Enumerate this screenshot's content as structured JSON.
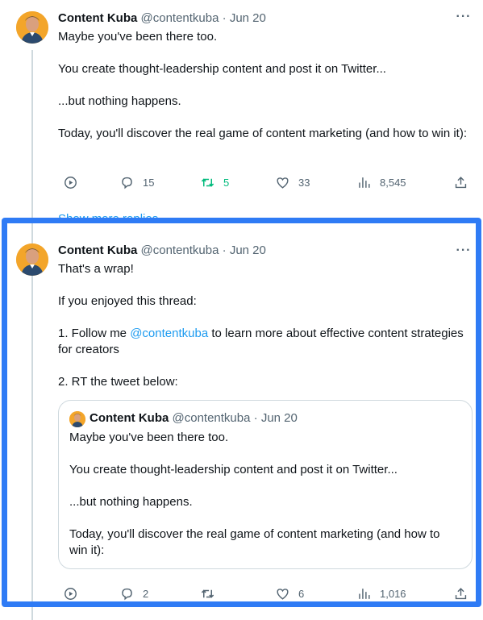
{
  "tweet1": {
    "author": "Content Kuba",
    "handle": "@contentkuba",
    "separator": "·",
    "date": "Jun 20",
    "more": "···",
    "paragraphs": [
      "Maybe you've been there too.",
      "You create thought-leadership content and post it on Twitter...",
      "...but nothing happens.",
      "Today, you'll discover the real game of content marketing (and how to win it):"
    ],
    "stats": {
      "replies": "15",
      "retweets": "5",
      "likes": "33",
      "views": "8,545"
    },
    "show_replies": "Show more replies"
  },
  "tweet2": {
    "author": "Content Kuba",
    "handle": "@contentkuba",
    "separator": "·",
    "date": "Jun 20",
    "more": "···",
    "p1": "That's a wrap!",
    "p2": "If you enjoyed this thread:",
    "p3_before": "1. Follow me ",
    "p3_mention": "@contentkuba",
    "p3_after": " to learn more about effective content strategies for creators",
    "p4": "2. RT the tweet below:",
    "quoted": {
      "author": "Content Kuba",
      "handle": "@contentkuba",
      "separator": "·",
      "date": "Jun 20",
      "paragraphs": [
        "Maybe you've been there too.",
        "You create thought-leadership content and post it on Twitter...",
        "...but nothing happens.",
        "Today, you'll discover the real game of content marketing (and how to win it):"
      ]
    },
    "stats": {
      "replies": "2",
      "retweets": "",
      "likes": "6",
      "views": "1,016"
    }
  },
  "icons": {
    "view": "play-circle-icon",
    "reply": "reply-icon",
    "retweet": "retweet-icon",
    "like": "heart-icon",
    "stats": "bar-chart-icon",
    "share": "share-icon"
  },
  "colors": {
    "accent": "#1d9bf0",
    "retweet_active": "#00ba7c",
    "highlight_border": "#2f7bf5",
    "muted_text": "#536471"
  }
}
